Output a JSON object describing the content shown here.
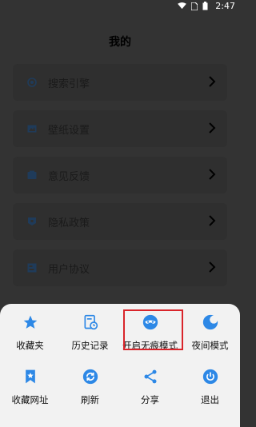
{
  "status_bar": {
    "time": "2:47"
  },
  "page": {
    "title": "我的"
  },
  "menu": {
    "items": [
      {
        "label": "搜索引擎",
        "icon": "search-engine-icon"
      },
      {
        "label": "壁纸设置",
        "icon": "wallpaper-icon"
      },
      {
        "label": "意见反馈",
        "icon": "feedback-icon"
      },
      {
        "label": "隐私政策",
        "icon": "privacy-icon"
      },
      {
        "label": "用户协议",
        "icon": "agreement-icon"
      }
    ]
  },
  "sheet": {
    "items": [
      {
        "label": "收藏夹",
        "icon": "star-icon"
      },
      {
        "label": "历史记录",
        "icon": "history-icon"
      },
      {
        "label": "开启无痕模式",
        "icon": "incognito-mask-icon"
      },
      {
        "label": "夜间模式",
        "icon": "night-mode-icon"
      },
      {
        "label": "收藏网址",
        "icon": "bookmark-icon"
      },
      {
        "label": "刷新",
        "icon": "refresh-icon"
      },
      {
        "label": "分享",
        "icon": "share-icon"
      },
      {
        "label": "退出",
        "icon": "power-icon"
      }
    ]
  },
  "colors": {
    "accent": "#2d88e6",
    "highlight": "#d9252b",
    "dim_background": "#333333"
  }
}
